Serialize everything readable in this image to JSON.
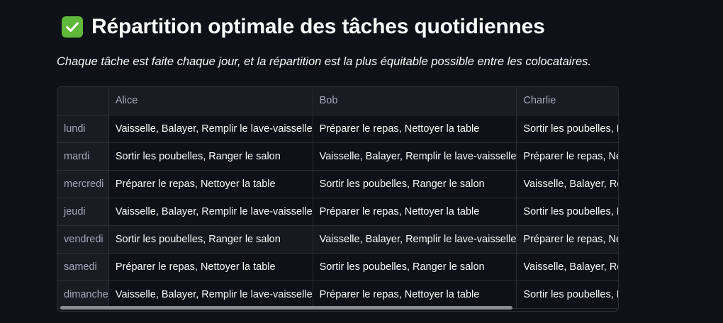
{
  "heading": {
    "icon": "check-mark-button-icon",
    "icon_color": "#5fb83a",
    "title": "Répartition optimale des tâches quotidiennes"
  },
  "subtitle": "Chaque tâche est faite chaque jour, et la répartition est la plus équitable possible entre les colocataires.",
  "table": {
    "columns": [
      "",
      "Alice",
      "Bob",
      "Charlie"
    ],
    "rows": [
      {
        "day": "lundi",
        "cells": [
          "Vaisselle, Balayer, Remplir le lave-vaisselle",
          "Préparer le repas, Nettoyer la table",
          "Sortir les poubelles, Ranger le salon"
        ]
      },
      {
        "day": "mardi",
        "cells": [
          "Sortir les poubelles, Ranger le salon",
          "Vaisselle, Balayer, Remplir le lave-vaisselle",
          "Préparer le repas, Nettoyer la table"
        ]
      },
      {
        "day": "mercredi",
        "cells": [
          "Préparer le repas, Nettoyer la table",
          "Sortir les poubelles, Ranger le salon",
          "Vaisselle, Balayer, Remplir le lave-vaisselle"
        ]
      },
      {
        "day": "jeudi",
        "cells": [
          "Vaisselle, Balayer, Remplir le lave-vaisselle",
          "Préparer le repas, Nettoyer la table",
          "Sortir les poubelles, Ranger le salon"
        ]
      },
      {
        "day": "vendredi",
        "cells": [
          "Sortir les poubelles, Ranger le salon",
          "Vaisselle, Balayer, Remplir le lave-vaisselle",
          "Préparer le repas, Nettoyer la table"
        ]
      },
      {
        "day": "samedi",
        "cells": [
          "Préparer le repas, Nettoyer la table",
          "Sortir les poubelles, Ranger le salon",
          "Vaisselle, Balayer, Remplir le lave-vaisselle"
        ]
      },
      {
        "day": "dimanche",
        "cells": [
          "Vaisselle, Balayer, Remplir le lave-vaisselle",
          "Préparer le repas, Nettoyer la table",
          "Sortir les poubelles, Ranger le salon"
        ]
      }
    ]
  }
}
